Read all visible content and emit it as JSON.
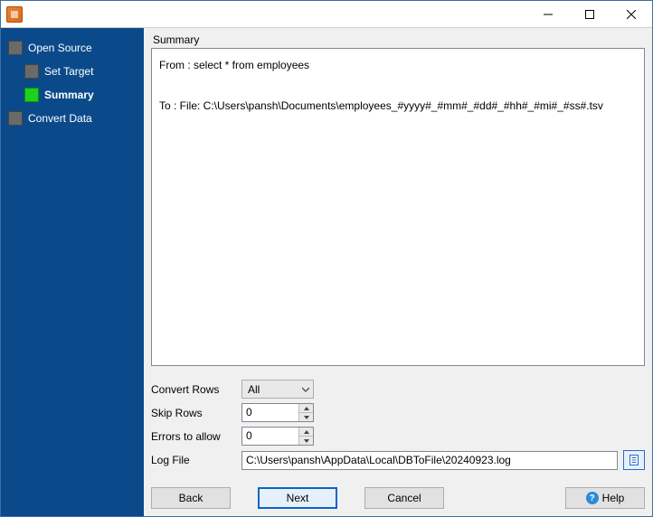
{
  "titlebar": {
    "title": ""
  },
  "sidebar": {
    "items": [
      {
        "label": "Open Source",
        "active": false
      },
      {
        "label": "Set Target",
        "active": false
      },
      {
        "label": "Summary",
        "active": true
      },
      {
        "label": "Convert Data",
        "active": false
      }
    ]
  },
  "main": {
    "section_title": "Summary",
    "summary_from": "From : select * from employees",
    "summary_to": "To : File: C:\\Users\\pansh\\Documents\\employees_#yyyy#_#mm#_#dd#_#hh#_#mi#_#ss#.tsv"
  },
  "form": {
    "convert_rows_label": "Convert Rows",
    "convert_rows_value": "All",
    "skip_rows_label": "Skip Rows",
    "skip_rows_value": "0",
    "errors_label": "Errors to allow",
    "errors_value": "0",
    "logfile_label": "Log File",
    "logfile_value": "C:\\Users\\pansh\\AppData\\Local\\DBToFile\\20240923.log"
  },
  "buttons": {
    "back": "Back",
    "next": "Next",
    "cancel": "Cancel",
    "help": "Help"
  }
}
